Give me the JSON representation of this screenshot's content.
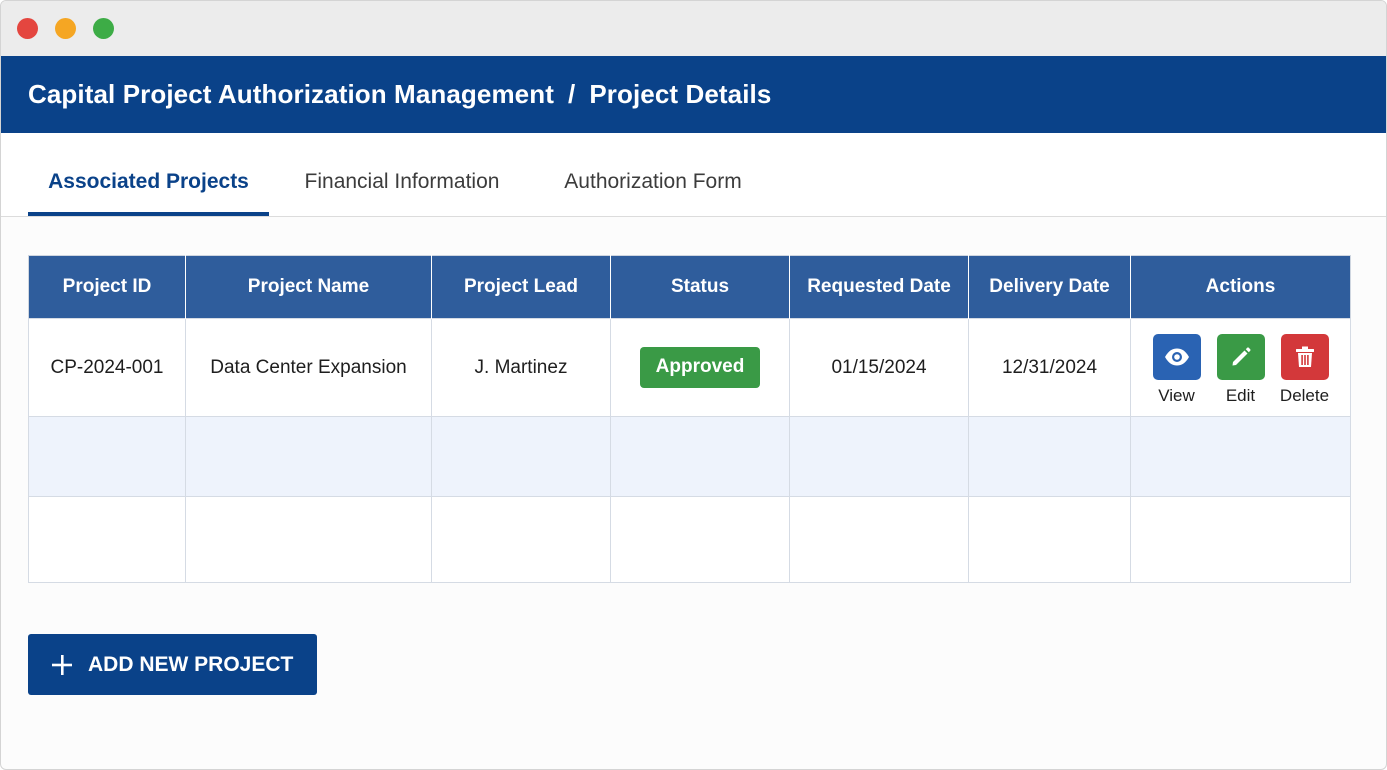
{
  "window": {
    "controls": [
      "close",
      "minimize",
      "maximize"
    ]
  },
  "header": {
    "app_name": "Capital Project Authorization Management",
    "separator": "/",
    "page_name": "Project Details"
  },
  "tabs": [
    {
      "label": "Associated Projects",
      "active": true
    },
    {
      "label": "Financial Information",
      "active": false
    },
    {
      "label": "Authorization Form",
      "active": false
    }
  ],
  "table": {
    "columns": [
      "Project ID",
      "Project Name",
      "Project Lead",
      "Status",
      "Requested Date",
      "Delivery Date",
      "Actions"
    ],
    "rows": [
      {
        "project_id": "CP-2024-001",
        "project_name": "Data Center Expansion",
        "project_lead": "J. Martinez",
        "status": "Approved",
        "requested_date": "01/15/2024",
        "delivery_date": "12/31/2024"
      }
    ],
    "actions": {
      "view": {
        "label": "View",
        "icon": "eye-icon",
        "color": "#2a63b3"
      },
      "edit": {
        "label": "Edit",
        "icon": "pencil-icon",
        "color": "#3a9a46"
      },
      "delete": {
        "label": "Delete",
        "icon": "trash-icon",
        "color": "#d3383a"
      }
    }
  },
  "add_button": {
    "label": "ADD NEW PROJECT",
    "icon": "plus-icon"
  },
  "colors": {
    "brand": "#0a4289",
    "table_header": "#2f5d9c",
    "status_approved": "#3a9a46",
    "alt_row": "#eef3fc"
  }
}
